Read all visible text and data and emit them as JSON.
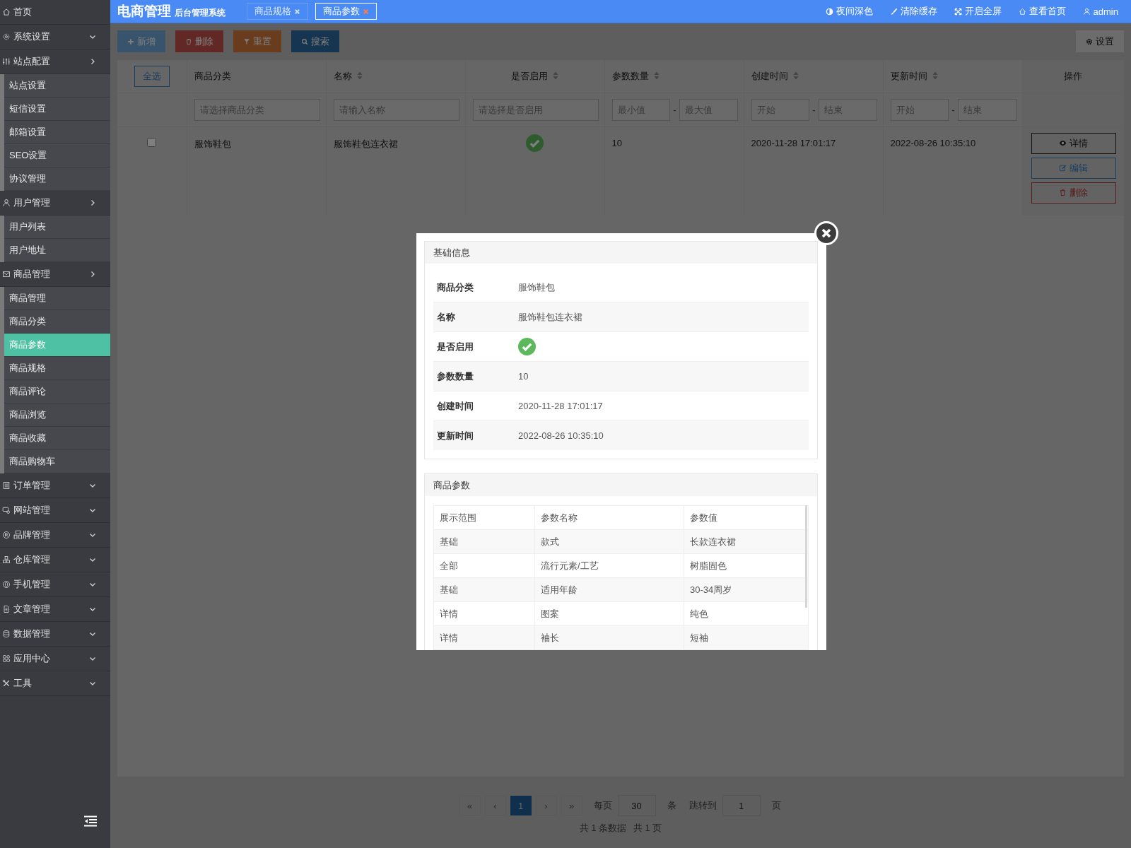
{
  "header": {
    "title": "电商管理",
    "subtitle": "后台管理系统",
    "tabs": [
      {
        "label": "商品规格",
        "selected": false
      },
      {
        "label": "商品参数",
        "selected": true
      }
    ],
    "links": [
      {
        "label": "夜间深色"
      },
      {
        "label": "清除缓存"
      },
      {
        "label": "开启全屏"
      },
      {
        "label": "查看首页"
      },
      {
        "label": "admin"
      }
    ]
  },
  "sidebar": {
    "items": [
      {
        "label": "首页",
        "kind": "link"
      },
      {
        "label": "系统设置",
        "kind": "group",
        "expanded": false
      },
      {
        "label": "站点配置",
        "kind": "group",
        "expanded": true,
        "children": [
          {
            "label": "站点设置",
            "selected": false
          },
          {
            "label": "短信设置",
            "selected": false
          },
          {
            "label": "邮箱设置",
            "selected": false
          },
          {
            "label": "SEO设置",
            "selected": false
          },
          {
            "label": "协议管理",
            "selected": false
          }
        ]
      },
      {
        "label": "用户管理",
        "kind": "group",
        "expanded": true,
        "children": [
          {
            "label": "用户列表",
            "selected": false
          },
          {
            "label": "用户地址",
            "selected": false
          }
        ]
      },
      {
        "label": "商品管理",
        "kind": "group",
        "expanded": true,
        "children": [
          {
            "label": "商品管理",
            "selected": false
          },
          {
            "label": "商品分类",
            "selected": false
          },
          {
            "label": "商品参数",
            "selected": true
          },
          {
            "label": "商品规格",
            "selected": false
          },
          {
            "label": "商品评论",
            "selected": false
          },
          {
            "label": "商品浏览",
            "selected": false
          },
          {
            "label": "商品收藏",
            "selected": false
          },
          {
            "label": "商品购物车",
            "selected": false
          }
        ]
      },
      {
        "label": "订单管理",
        "kind": "group",
        "expanded": false
      },
      {
        "label": "网站管理",
        "kind": "group",
        "expanded": false
      },
      {
        "label": "品牌管理",
        "kind": "group",
        "expanded": false
      },
      {
        "label": "仓库管理",
        "kind": "group",
        "expanded": false
      },
      {
        "label": "手机管理",
        "kind": "group",
        "expanded": false
      },
      {
        "label": "文章管理",
        "kind": "group",
        "expanded": false
      },
      {
        "label": "数据管理",
        "kind": "group",
        "expanded": false
      },
      {
        "label": "应用中心",
        "kind": "group",
        "expanded": false
      },
      {
        "label": "工具",
        "kind": "group",
        "expanded": false
      }
    ]
  },
  "toolbar": {
    "buttons": [
      {
        "label": "新增",
        "kind": "add"
      },
      {
        "label": "删除",
        "kind": "delete"
      },
      {
        "label": "重置",
        "kind": "reset"
      },
      {
        "label": "搜索",
        "kind": "search"
      }
    ],
    "settings": "设置"
  },
  "table": {
    "select_all": "全选",
    "columns": [
      {
        "label": "商品分类",
        "sortable": false
      },
      {
        "label": "名称",
        "sortable": true
      },
      {
        "label": "是否启用",
        "sortable": true
      },
      {
        "label": "参数数量",
        "sortable": true
      },
      {
        "label": "创建时间",
        "sortable": true
      },
      {
        "label": "更新时间",
        "sortable": true
      },
      {
        "label": "操作",
        "sortable": false
      }
    ],
    "filters": [
      {
        "kind": "text",
        "placeholder": "请选择商品分类"
      },
      {
        "kind": "text",
        "placeholder": "请输入名称"
      },
      {
        "kind": "text",
        "placeholder": "请选择是否启用"
      },
      {
        "kind": "range",
        "placeholder": "最小值",
        "separator": "-",
        "placeholder_end": "最大值"
      },
      {
        "kind": "range",
        "placeholder": "开始",
        "separator": "-",
        "placeholder_end": "结束"
      },
      {
        "kind": "range",
        "placeholder": "开始",
        "separator": "-",
        "placeholder_end": "结束"
      },
      {
        "kind": "none"
      }
    ],
    "rows": [
      {
        "checked": false,
        "category": "服饰鞋包",
        "name": "服饰鞋包连衣裙",
        "enabled": true,
        "param_count": "10",
        "created": "2020-11-28 17:01:17",
        "updated": "2022-08-26 10:35:10",
        "actions": [
          {
            "label": "详情",
            "kind": "view"
          },
          {
            "label": "编辑",
            "kind": "edit"
          },
          {
            "label": "删除",
            "kind": "delete"
          }
        ]
      }
    ]
  },
  "pagination": {
    "first": "«",
    "prev": "‹",
    "pages": [
      {
        "label": "1",
        "selected": true
      }
    ],
    "next": "›",
    "last": "»",
    "per_page_label": "每页",
    "per_page": "30",
    "per_page_unit": "条",
    "jump_label": "跳转到",
    "jump_page": "1",
    "jump_unit": "页",
    "total_rows": "共 1 条数据",
    "total_pages": "共 1 页"
  },
  "modal": {
    "info_title": "基础信息",
    "fields": [
      {
        "kind": "text",
        "label": "商品分类",
        "value": "服饰鞋包"
      },
      {
        "kind": "text",
        "label": "名称",
        "value": "服饰鞋包连衣裙"
      },
      {
        "kind": "check",
        "label": "是否启用",
        "enabled": true
      },
      {
        "kind": "text",
        "label": "参数数量",
        "value": "10"
      },
      {
        "kind": "text",
        "label": "创建时间",
        "value": "2020-11-28 17:01:17"
      },
      {
        "kind": "text",
        "label": "更新时间",
        "value": "2022-08-26 10:35:10"
      }
    ],
    "params_title": "商品参数",
    "param_columns": [
      "展示范围",
      "参数名称",
      "参数值"
    ],
    "param_rows": [
      [
        "基础",
        "款式",
        "长款连衣裙"
      ],
      [
        "全部",
        "流行元素/工艺",
        "树脂固色"
      ],
      [
        "基础",
        "适用年龄",
        "30-34周岁"
      ],
      [
        "详情",
        "图案",
        "纯色"
      ],
      [
        "详情",
        "袖长",
        "短袖"
      ]
    ]
  }
}
